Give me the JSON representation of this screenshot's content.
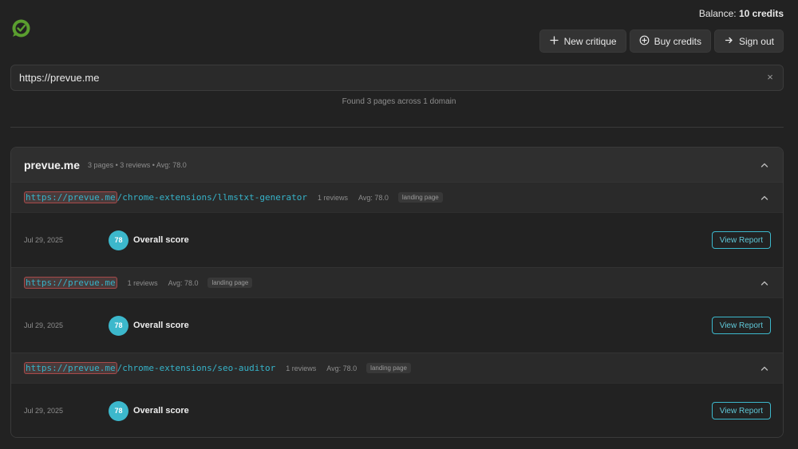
{
  "header": {
    "balance_prefix": "Balance: ",
    "balance_value": "10 credits",
    "actions": {
      "new_critique": "New critique",
      "buy_credits": "Buy credits",
      "sign_out": "Sign out"
    }
  },
  "search": {
    "value": "https://prevue.me",
    "clear_icon": "×",
    "found_text": "Found 3 pages across 1 domain"
  },
  "domain": {
    "name": "prevue.me",
    "meta": "3 pages • 3 reviews • Avg: 78.0"
  },
  "pages": [
    {
      "url_highlight": "https://prevue.me",
      "url_rest": "/chrome-extensions/llmstxt-generator",
      "reviews": "1 reviews",
      "avg": "Avg: 78.0",
      "tag": "landing page",
      "review": {
        "date": "Jul 29, 2025",
        "score": "78",
        "label": "Overall score",
        "button": "View Report"
      }
    },
    {
      "url_highlight": "https://prevue.me",
      "url_rest": "",
      "reviews": "1 reviews",
      "avg": "Avg: 78.0",
      "tag": "landing page",
      "review": {
        "date": "Jul 29, 2025",
        "score": "78",
        "label": "Overall score",
        "button": "View Report"
      }
    },
    {
      "url_highlight": "https://prevue.me",
      "url_rest": "/chrome-extensions/seo-auditor",
      "reviews": "1 reviews",
      "avg": "Avg: 78.0",
      "tag": "landing page",
      "review": {
        "date": "Jul 29, 2025",
        "score": "78",
        "label": "Overall score",
        "button": "View Report"
      }
    }
  ],
  "colors": {
    "background": "#222222",
    "accent": "#3cb8cc",
    "logo": "#5a9e2f"
  },
  "icons": {
    "logo": "check-circle-logo-icon",
    "new_critique": "plus-icon",
    "buy_credits": "plus-circle-icon",
    "sign_out": "arrow-right-icon",
    "collapse": "chevron-up-icon"
  }
}
